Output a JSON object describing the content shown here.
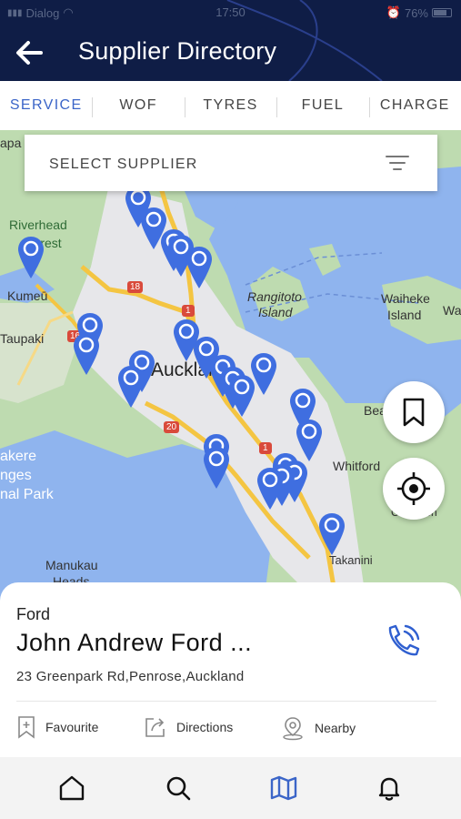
{
  "status_bar": {
    "carrier": "Dialog",
    "time": "17:50",
    "battery": "76%"
  },
  "header": {
    "title": "Supplier Directory"
  },
  "tabs": [
    {
      "label": "SERVICE",
      "active": true
    },
    {
      "label": "WOF",
      "active": false
    },
    {
      "label": "TYRES",
      "active": false
    },
    {
      "label": "FUEL",
      "active": false
    },
    {
      "label": "CHARGE",
      "active": false
    }
  ],
  "search": {
    "label": "SELECT SUPPLIER"
  },
  "map_labels": {
    "apa": "apa",
    "riverhead": "Riverhead",
    "forest": "Forest",
    "kumeu": "Kumeū",
    "taupaki": "Taupaki",
    "rangitoto": "Rangitoto",
    "island": "Island",
    "waiheke": "Waiheke",
    "waiheke_island": "Island",
    "wa": "Wa",
    "auckland": "Auckland",
    "bea": "Bea",
    "whitford": "Whitford",
    "clevedon": "Clevedon",
    "akere": "akere",
    "nges": "nges",
    "nal_park": "nal Park",
    "manukau": "Manukau",
    "heads": "Heads",
    "takanini": "Takanini",
    "road_18": "18",
    "road_16": "16",
    "road_1a": "1",
    "road_20": "20",
    "road_1b": "1"
  },
  "selected_supplier": {
    "brand": "Ford",
    "name": "John Andrew Ford ...",
    "address": "23 Greenpark Rd,Penrose,Auckland"
  },
  "card_actions": {
    "favourite": "Favourite",
    "directions": "Directions",
    "nearby": "Nearby"
  },
  "colors": {
    "header": "#0f1d46",
    "accent": "#3b65c8",
    "pin": "#3f6ee0"
  },
  "icons": {
    "back": "arrow-left-icon",
    "filter": "filter-icon",
    "bookmark": "bookmark-icon",
    "locate": "crosshair-icon",
    "call": "phone-icon",
    "home": "home-icon",
    "search": "search-icon",
    "map": "map-icon",
    "notifications": "bell-icon"
  }
}
